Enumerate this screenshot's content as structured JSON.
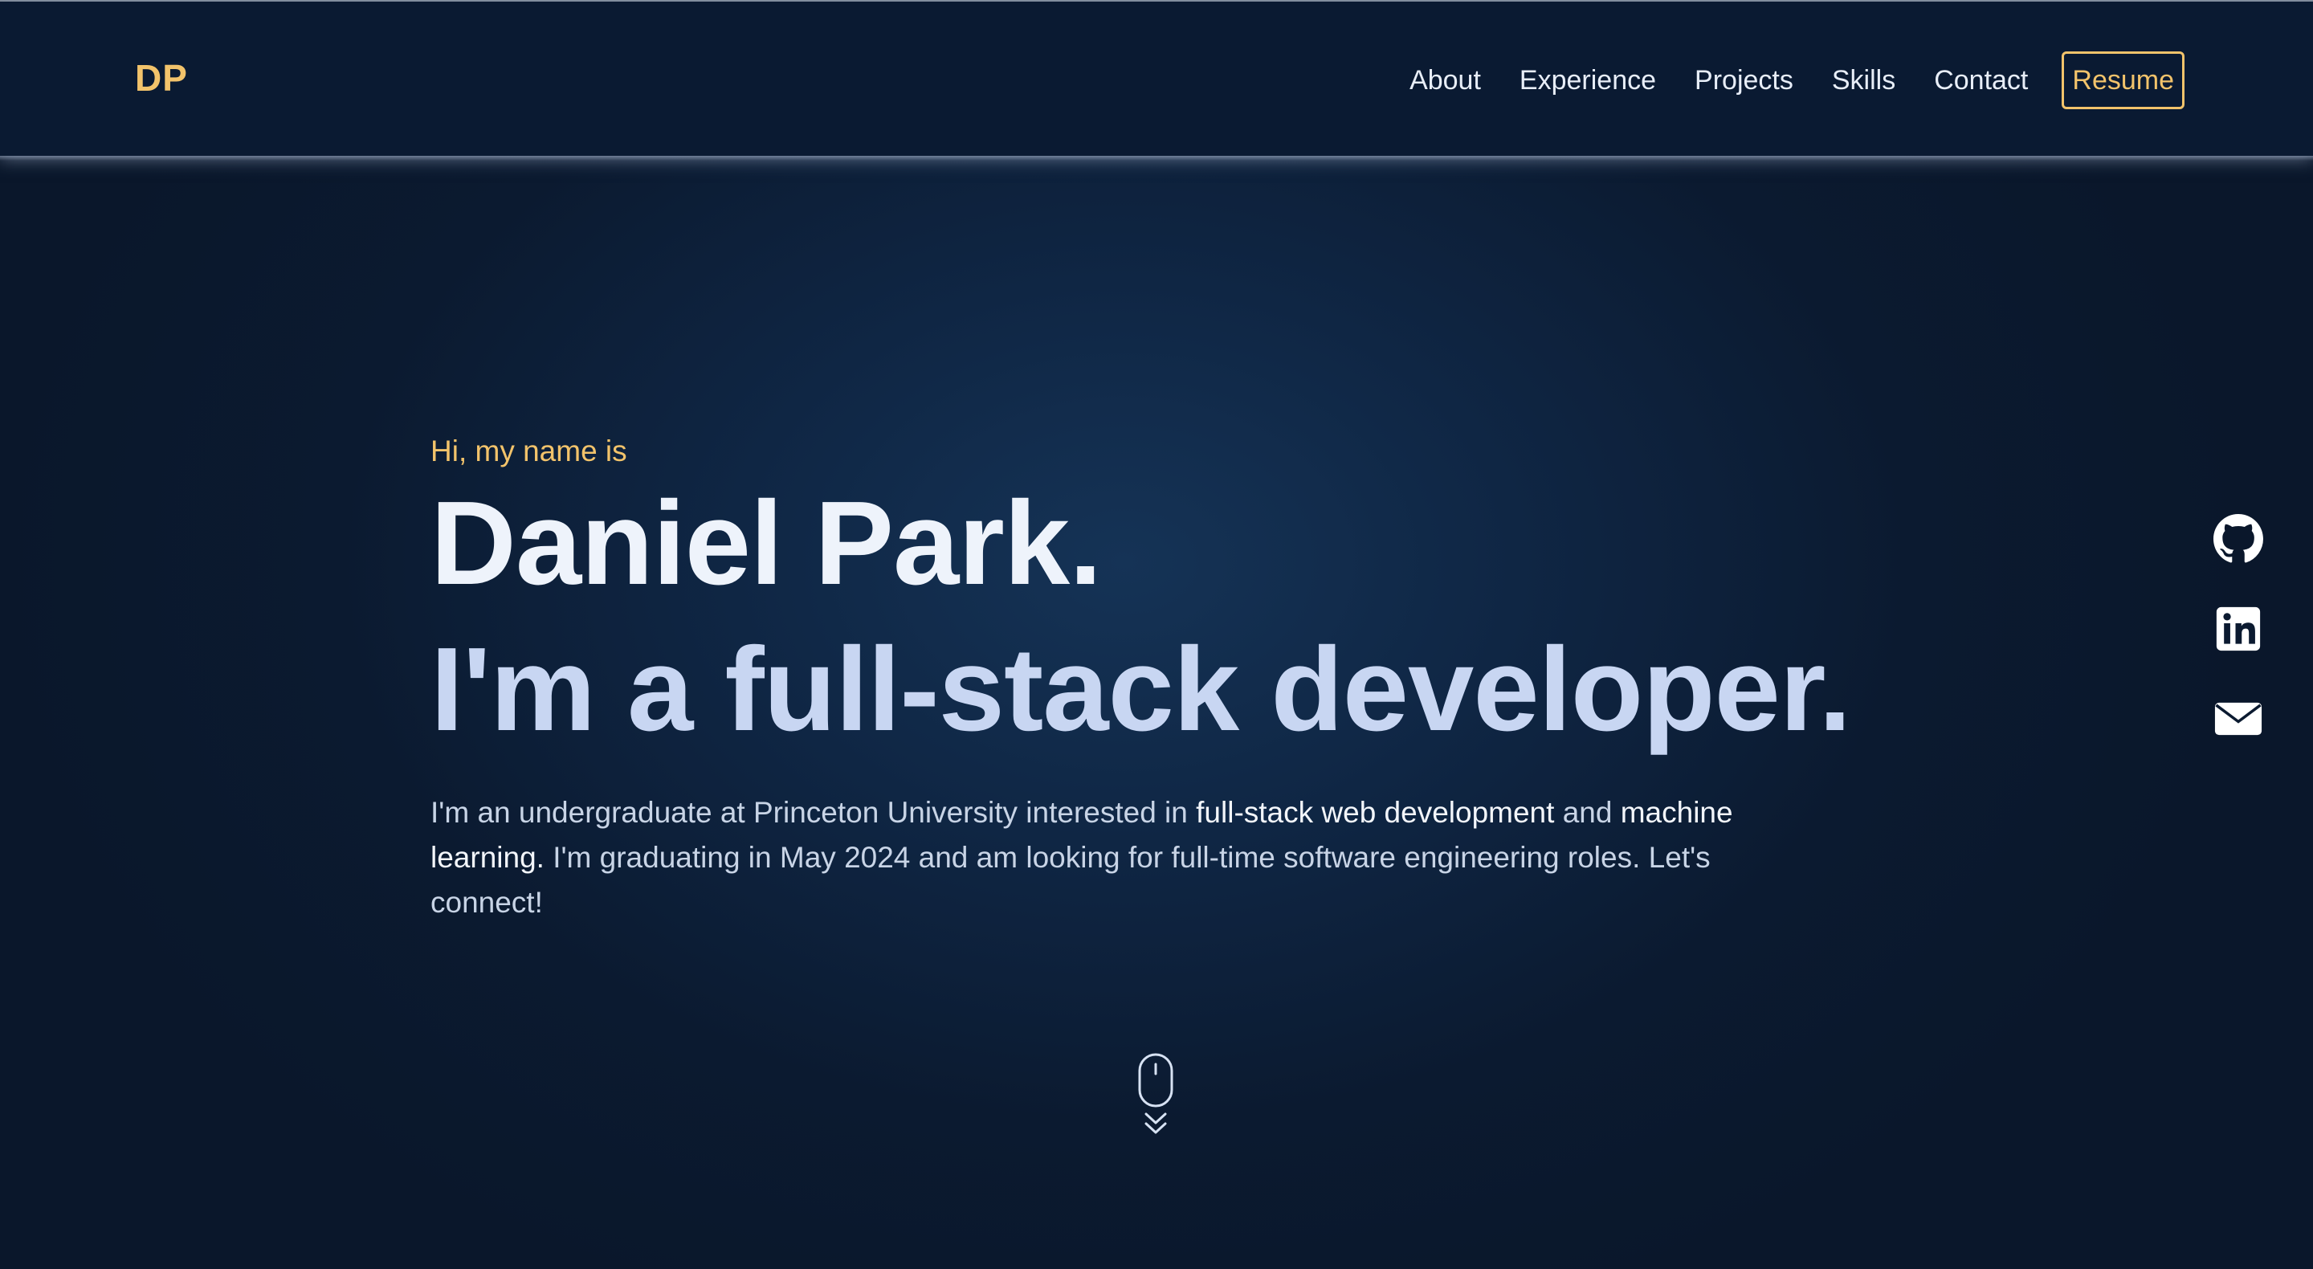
{
  "header": {
    "logo": "DP",
    "nav": [
      "About",
      "Experience",
      "Projects",
      "Skills",
      "Contact"
    ],
    "resume_label": "Resume"
  },
  "hero": {
    "greeting": "Hi, my name is",
    "name": "Daniel Park.",
    "tagline": "I'm a full-stack developer.",
    "bio": {
      "part1": "I'm an undergraduate at Princeton University interested in ",
      "highlight1": "full-stack web development",
      "part2": " and ",
      "highlight2": "machine learning.",
      "part3": " I'm graduating in May 2024 and am looking for full-time software engineering roles. Let's connect!"
    }
  },
  "social": {
    "icons": [
      "github-icon",
      "linkedin-icon",
      "email-icon"
    ]
  },
  "scroll": {
    "icons": [
      "mouse-icon",
      "double-chevron-down-icon"
    ]
  },
  "colors": {
    "accent": "#f2c36b",
    "background": "#0a192f",
    "heading": "#eef3fb",
    "tagline": "#c8d6f2",
    "body": "#c8d4e6"
  }
}
